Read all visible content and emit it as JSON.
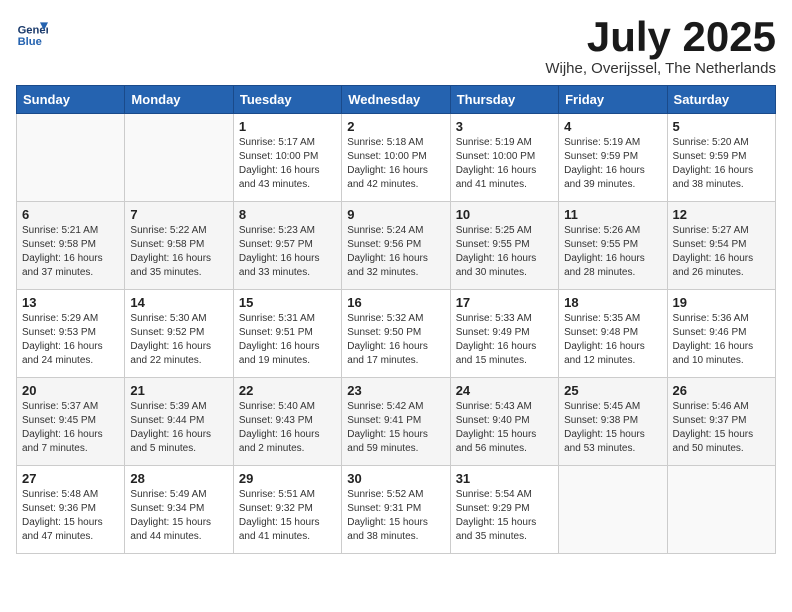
{
  "logo": {
    "line1": "General",
    "line2": "Blue"
  },
  "title": "July 2025",
  "subtitle": "Wijhe, Overijssel, The Netherlands",
  "headers": [
    "Sunday",
    "Monday",
    "Tuesday",
    "Wednesday",
    "Thursday",
    "Friday",
    "Saturday"
  ],
  "weeks": [
    [
      {
        "day": "",
        "detail": ""
      },
      {
        "day": "",
        "detail": ""
      },
      {
        "day": "1",
        "detail": "Sunrise: 5:17 AM\nSunset: 10:00 PM\nDaylight: 16 hours\nand 43 minutes."
      },
      {
        "day": "2",
        "detail": "Sunrise: 5:18 AM\nSunset: 10:00 PM\nDaylight: 16 hours\nand 42 minutes."
      },
      {
        "day": "3",
        "detail": "Sunrise: 5:19 AM\nSunset: 10:00 PM\nDaylight: 16 hours\nand 41 minutes."
      },
      {
        "day": "4",
        "detail": "Sunrise: 5:19 AM\nSunset: 9:59 PM\nDaylight: 16 hours\nand 39 minutes."
      },
      {
        "day": "5",
        "detail": "Sunrise: 5:20 AM\nSunset: 9:59 PM\nDaylight: 16 hours\nand 38 minutes."
      }
    ],
    [
      {
        "day": "6",
        "detail": "Sunrise: 5:21 AM\nSunset: 9:58 PM\nDaylight: 16 hours\nand 37 minutes."
      },
      {
        "day": "7",
        "detail": "Sunrise: 5:22 AM\nSunset: 9:58 PM\nDaylight: 16 hours\nand 35 minutes."
      },
      {
        "day": "8",
        "detail": "Sunrise: 5:23 AM\nSunset: 9:57 PM\nDaylight: 16 hours\nand 33 minutes."
      },
      {
        "day": "9",
        "detail": "Sunrise: 5:24 AM\nSunset: 9:56 PM\nDaylight: 16 hours\nand 32 minutes."
      },
      {
        "day": "10",
        "detail": "Sunrise: 5:25 AM\nSunset: 9:55 PM\nDaylight: 16 hours\nand 30 minutes."
      },
      {
        "day": "11",
        "detail": "Sunrise: 5:26 AM\nSunset: 9:55 PM\nDaylight: 16 hours\nand 28 minutes."
      },
      {
        "day": "12",
        "detail": "Sunrise: 5:27 AM\nSunset: 9:54 PM\nDaylight: 16 hours\nand 26 minutes."
      }
    ],
    [
      {
        "day": "13",
        "detail": "Sunrise: 5:29 AM\nSunset: 9:53 PM\nDaylight: 16 hours\nand 24 minutes."
      },
      {
        "day": "14",
        "detail": "Sunrise: 5:30 AM\nSunset: 9:52 PM\nDaylight: 16 hours\nand 22 minutes."
      },
      {
        "day": "15",
        "detail": "Sunrise: 5:31 AM\nSunset: 9:51 PM\nDaylight: 16 hours\nand 19 minutes."
      },
      {
        "day": "16",
        "detail": "Sunrise: 5:32 AM\nSunset: 9:50 PM\nDaylight: 16 hours\nand 17 minutes."
      },
      {
        "day": "17",
        "detail": "Sunrise: 5:33 AM\nSunset: 9:49 PM\nDaylight: 16 hours\nand 15 minutes."
      },
      {
        "day": "18",
        "detail": "Sunrise: 5:35 AM\nSunset: 9:48 PM\nDaylight: 16 hours\nand 12 minutes."
      },
      {
        "day": "19",
        "detail": "Sunrise: 5:36 AM\nSunset: 9:46 PM\nDaylight: 16 hours\nand 10 minutes."
      }
    ],
    [
      {
        "day": "20",
        "detail": "Sunrise: 5:37 AM\nSunset: 9:45 PM\nDaylight: 16 hours\nand 7 minutes."
      },
      {
        "day": "21",
        "detail": "Sunrise: 5:39 AM\nSunset: 9:44 PM\nDaylight: 16 hours\nand 5 minutes."
      },
      {
        "day": "22",
        "detail": "Sunrise: 5:40 AM\nSunset: 9:43 PM\nDaylight: 16 hours\nand 2 minutes."
      },
      {
        "day": "23",
        "detail": "Sunrise: 5:42 AM\nSunset: 9:41 PM\nDaylight: 15 hours\nand 59 minutes."
      },
      {
        "day": "24",
        "detail": "Sunrise: 5:43 AM\nSunset: 9:40 PM\nDaylight: 15 hours\nand 56 minutes."
      },
      {
        "day": "25",
        "detail": "Sunrise: 5:45 AM\nSunset: 9:38 PM\nDaylight: 15 hours\nand 53 minutes."
      },
      {
        "day": "26",
        "detail": "Sunrise: 5:46 AM\nSunset: 9:37 PM\nDaylight: 15 hours\nand 50 minutes."
      }
    ],
    [
      {
        "day": "27",
        "detail": "Sunrise: 5:48 AM\nSunset: 9:36 PM\nDaylight: 15 hours\nand 47 minutes."
      },
      {
        "day": "28",
        "detail": "Sunrise: 5:49 AM\nSunset: 9:34 PM\nDaylight: 15 hours\nand 44 minutes."
      },
      {
        "day": "29",
        "detail": "Sunrise: 5:51 AM\nSunset: 9:32 PM\nDaylight: 15 hours\nand 41 minutes."
      },
      {
        "day": "30",
        "detail": "Sunrise: 5:52 AM\nSunset: 9:31 PM\nDaylight: 15 hours\nand 38 minutes."
      },
      {
        "day": "31",
        "detail": "Sunrise: 5:54 AM\nSunset: 9:29 PM\nDaylight: 15 hours\nand 35 minutes."
      },
      {
        "day": "",
        "detail": ""
      },
      {
        "day": "",
        "detail": ""
      }
    ]
  ]
}
